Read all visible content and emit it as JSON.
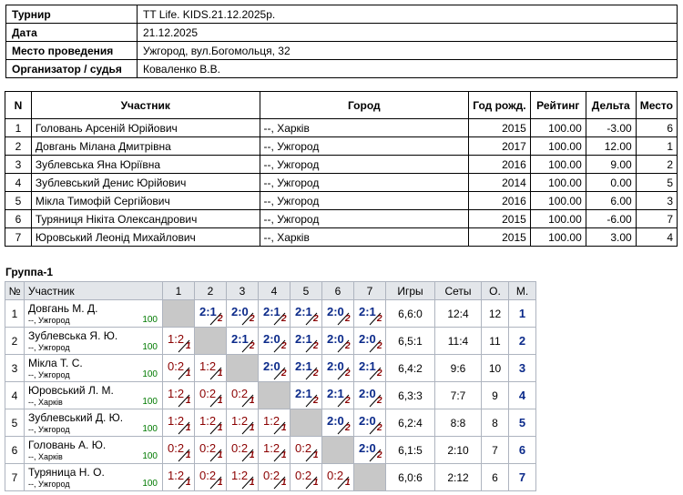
{
  "info": [
    {
      "label": "Турнир",
      "value": "TT Life. KIDS.21.12.2025р."
    },
    {
      "label": "Дата",
      "value": "21.12.2025"
    },
    {
      "label": "Место проведения",
      "value": "Ужгород, вул.Богомольця, 32"
    },
    {
      "label": "Организатор / судья",
      "value": "Коваленко В.В."
    }
  ],
  "participants": {
    "headers": [
      "N",
      "Участник",
      "Город",
      "Год рожд.",
      "Рейтинг",
      "Дельта",
      "Место"
    ],
    "rows": [
      [
        "1",
        "Головань Арсеній Юрійович",
        "--, Харків",
        "2015",
        "100.00",
        "-3.00",
        "6"
      ],
      [
        "2",
        "Довгань Мілана Дмитрівна",
        "--, Ужгород",
        "2017",
        "100.00",
        "12.00",
        "1"
      ],
      [
        "3",
        "Зублевська Яна Юріївна",
        "--, Ужгород",
        "2016",
        "100.00",
        "9.00",
        "2"
      ],
      [
        "4",
        "Зублевський Денис Юрійович",
        "--, Ужгород",
        "2014",
        "100.00",
        "0.00",
        "5"
      ],
      [
        "5",
        "Мікла Тимофій Сергійович",
        "--, Ужгород",
        "2016",
        "100.00",
        "6.00",
        "3"
      ],
      [
        "6",
        "Туряниця Нікіта Олександрович",
        "--, Ужгород",
        "2015",
        "100.00",
        "-6.00",
        "7"
      ],
      [
        "7",
        "Юровський Леонід Михайлович",
        "--, Харків",
        "2015",
        "100.00",
        "3.00",
        "4"
      ]
    ]
  },
  "group": {
    "title": "Группа-1",
    "headers": {
      "no": "№",
      "name": "Участник",
      "cols": [
        "1",
        "2",
        "3",
        "4",
        "5",
        "6",
        "7"
      ],
      "games": "Игры",
      "sets": "Сеты",
      "points": "О.",
      "place": "М."
    },
    "rows": [
      {
        "no": "1",
        "name": "Довгань М. Д.",
        "city": "--, Ужгород",
        "rating": "100",
        "results": [
          null,
          [
            "2:1",
            "2"
          ],
          [
            "2:0",
            "2"
          ],
          [
            "2:1",
            "2"
          ],
          [
            "2:1",
            "2"
          ],
          [
            "2:0",
            "2"
          ],
          [
            "2:1",
            "2"
          ]
        ],
        "games": "6,6:0",
        "sets": "12:4",
        "points": "12",
        "place": "1"
      },
      {
        "no": "2",
        "name": "Зублевська Я. Ю.",
        "city": "--, Ужгород",
        "rating": "100",
        "results": [
          [
            "1:2",
            "1"
          ],
          null,
          [
            "2:1",
            "2"
          ],
          [
            "2:0",
            "2"
          ],
          [
            "2:1",
            "2"
          ],
          [
            "2:0",
            "2"
          ],
          [
            "2:0",
            "2"
          ]
        ],
        "games": "6,5:1",
        "sets": "11:4",
        "points": "11",
        "place": "2"
      },
      {
        "no": "3",
        "name": "Мікла Т. С.",
        "city": "--, Ужгород",
        "rating": "100",
        "results": [
          [
            "0:2",
            "1"
          ],
          [
            "1:2",
            "1"
          ],
          null,
          [
            "2:0",
            "2"
          ],
          [
            "2:1",
            "2"
          ],
          [
            "2:0",
            "2"
          ],
          [
            "2:1",
            "2"
          ]
        ],
        "games": "6,4:2",
        "sets": "9:6",
        "points": "10",
        "place": "3"
      },
      {
        "no": "4",
        "name": "Юровський Л. М.",
        "city": "--, Харків",
        "rating": "100",
        "results": [
          [
            "1:2",
            "1"
          ],
          [
            "0:2",
            "1"
          ],
          [
            "0:2",
            "1"
          ],
          null,
          [
            "2:1",
            "2"
          ],
          [
            "2:1",
            "2"
          ],
          [
            "2:0",
            "2"
          ]
        ],
        "games": "6,3:3",
        "sets": "7:7",
        "points": "9",
        "place": "4"
      },
      {
        "no": "5",
        "name": "Зублевський Д. Ю.",
        "city": "--, Ужгород",
        "rating": "100",
        "results": [
          [
            "1:2",
            "1"
          ],
          [
            "1:2",
            "1"
          ],
          [
            "1:2",
            "1"
          ],
          [
            "1:2",
            "1"
          ],
          null,
          [
            "2:0",
            "2"
          ],
          [
            "2:0",
            "2"
          ]
        ],
        "games": "6,2:4",
        "sets": "8:8",
        "points": "8",
        "place": "5"
      },
      {
        "no": "6",
        "name": "Головань А. Ю.",
        "city": "--, Харків",
        "rating": "100",
        "results": [
          [
            "0:2",
            "1"
          ],
          [
            "0:2",
            "1"
          ],
          [
            "0:2",
            "1"
          ],
          [
            "1:2",
            "1"
          ],
          [
            "0:2",
            "1"
          ],
          null,
          [
            "2:0",
            "2"
          ]
        ],
        "games": "6,1:5",
        "sets": "2:10",
        "points": "7",
        "place": "6"
      },
      {
        "no": "7",
        "name": "Туряница Н. О.",
        "city": "--, Ужгород",
        "rating": "100",
        "results": [
          [
            "1:2",
            "1"
          ],
          [
            "0:2",
            "1"
          ],
          [
            "1:2",
            "1"
          ],
          [
            "0:2",
            "1"
          ],
          [
            "0:2",
            "1"
          ],
          [
            "0:2",
            "1"
          ],
          null
        ],
        "games": "6,0:6",
        "sets": "2:12",
        "points": "6",
        "place": "7"
      }
    ]
  }
}
